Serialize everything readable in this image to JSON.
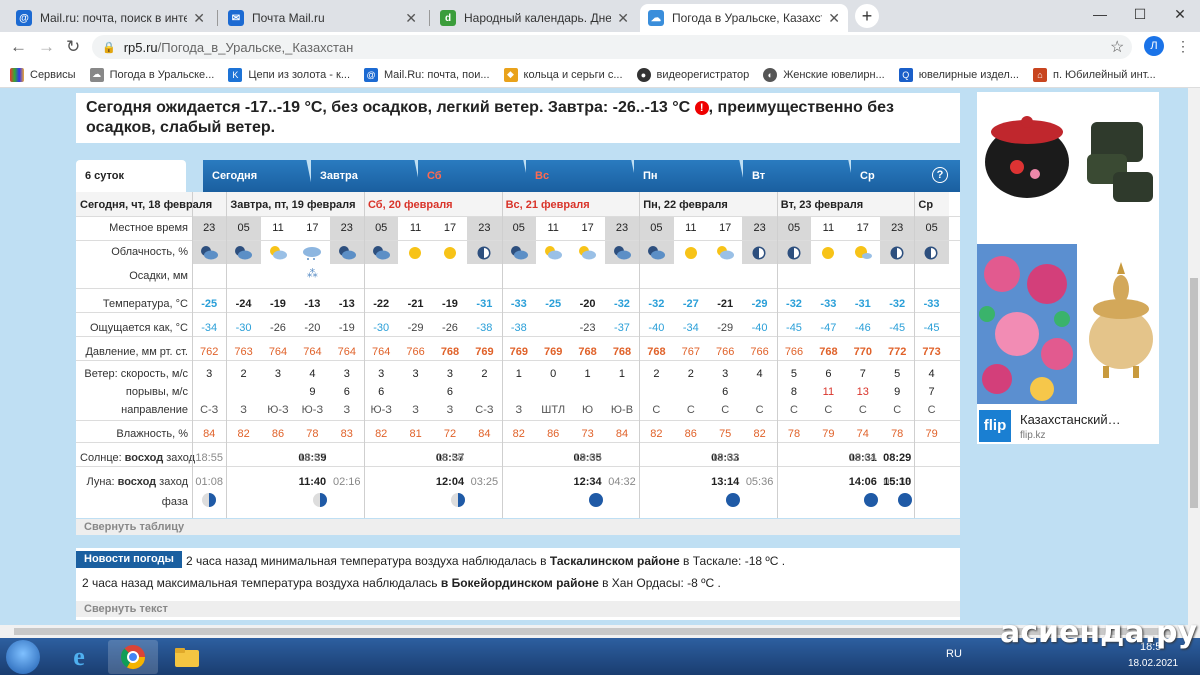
{
  "browser": {
    "tabs": [
      {
        "title": "Mail.ru: почта, поиск в интернете",
        "icon": "mailru-icon",
        "color": "#1c6ad2"
      },
      {
        "title": "Почта Mail.ru",
        "icon": "mail-icon",
        "color": "#1c6ad2"
      },
      {
        "title": "Народный календарь. Дневник",
        "icon": "calendar-icon",
        "color": "#3b9d3b"
      },
      {
        "title": "Погода в Уральске, Казахстан -",
        "icon": "weather-icon",
        "color": "#3a8edb"
      }
    ],
    "url_host": "rp5.ru",
    "url_path": "/Погода_в_Уральске,_Казахстан",
    "avatar_letter": "Л",
    "bookmarks": [
      "Сервисы",
      "Погода в Уральске...",
      "Цепи из золота - к...",
      "Mail.Ru: почта, пои...",
      "кольца и серьги с...",
      "видеорегистратор",
      "Женские ювелирн...",
      "ювелирные издел...",
      "п. Юбилейный инт..."
    ]
  },
  "forecast": {
    "line1": "Сегодня ожидается -17..-19 °С, без осадков, легкий ветер. Завтра: -26..-13 °С",
    "line1b": ", преимущественно без",
    "line2": "осадков, слабый ветер."
  },
  "weather_tabs": [
    {
      "label": "6 суток"
    },
    {
      "label": "Сегодня"
    },
    {
      "label": "Завтра"
    },
    {
      "label": "Сб",
      "red": true
    },
    {
      "label": "Вс",
      "red": true
    },
    {
      "label": "Пн"
    },
    {
      "label": "Вт"
    },
    {
      "label": "Ср"
    }
  ],
  "help_label": "?",
  "days": [
    {
      "title": "Сегодня, чт, 18 февраля",
      "red": false
    },
    {
      "title": "Завтра, пт, 19 февраля",
      "red": false
    },
    {
      "title": "Сб, 20 февраля",
      "red": true
    },
    {
      "title": "Вс, 21 февраля",
      "red": true
    },
    {
      "title": "Пн, 22 февраля",
      "red": false
    },
    {
      "title": "Вт, 23 февраля",
      "red": false
    },
    {
      "title": "Ср",
      "red": false
    }
  ],
  "row_labels": {
    "time": "Местное время",
    "cloud": "Облачность, %",
    "precip": "Осадки, мм",
    "temp": "Температура, °С",
    "feels": "Ощущается как, °С",
    "pressure": "Давление, мм рт. ст.",
    "wind_speed": "Ветер: скорость, м/с",
    "gusts": "порывы, м/с",
    "direction": "направление",
    "humidity": "Влажность, %",
    "sun_prefix": "Солнце:",
    "sun_rise": "восход",
    "sun_set": "заход",
    "moon_prefix": "Луна:",
    "moon_rise": "восход",
    "moon_set": "заход",
    "phase": "фаза"
  },
  "columns": [
    {
      "time": "23",
      "night": true,
      "icon": "cloud-moon",
      "temp": "-25",
      "feels": "-34",
      "pressure": "762",
      "wind": "3",
      "gust": "",
      "dir": "С-З",
      "hum": "84"
    },
    {
      "time": "05",
      "night": true,
      "icon": "cloud-moon",
      "temp": "-24",
      "feels": "-30",
      "pressure": "763",
      "wind": "2",
      "gust": "",
      "dir": "З",
      "hum": "82"
    },
    {
      "time": "11",
      "night": false,
      "icon": "cloud-sun",
      "temp": "-19",
      "feels": "-26",
      "pressure": "764",
      "wind": "3",
      "gust": "",
      "dir": "Ю-З",
      "hum": "86"
    },
    {
      "time": "17",
      "night": false,
      "icon": "cloud-snow",
      "temp": "-13",
      "feels": "-20",
      "pressure": "764",
      "wind": "4",
      "gust": "9",
      "dir": "Ю-З",
      "hum": "78"
    },
    {
      "time": "23",
      "night": true,
      "icon": "cloud-moon",
      "temp": "-13",
      "feels": "-19",
      "pressure": "764",
      "wind": "3",
      "gust": "6",
      "dir": "З",
      "hum": "83"
    },
    {
      "time": "05",
      "night": true,
      "icon": "cloud-moon",
      "temp": "-22",
      "feels": "-30",
      "pressure": "764",
      "wind": "3",
      "gust": "6",
      "dir": "Ю-З",
      "hum": "82"
    },
    {
      "time": "11",
      "night": false,
      "icon": "sun",
      "temp": "-21",
      "feels": "-29",
      "pressure": "766",
      "wind": "3",
      "gust": "",
      "dir": "З",
      "hum": "81"
    },
    {
      "time": "17",
      "night": false,
      "icon": "sun",
      "temp": "-19",
      "feels": "-26",
      "pressure": "768",
      "wind": "3",
      "gust": "6",
      "dir": "З",
      "hum": "72"
    },
    {
      "time": "23",
      "night": true,
      "icon": "moon",
      "temp": "-31",
      "feels": "-38",
      "pressure": "769",
      "wind": "2",
      "gust": "",
      "dir": "С-З",
      "hum": "84"
    },
    {
      "time": "05",
      "night": true,
      "icon": "cloud-moon",
      "temp": "-33",
      "feels": "-38",
      "pressure": "769",
      "wind": "1",
      "gust": "",
      "dir": "З",
      "hum": "82"
    },
    {
      "time": "11",
      "night": false,
      "icon": "cloud-sun",
      "temp": "-25",
      "feels": "",
      "pressure": "769",
      "wind": "0",
      "gust": "",
      "dir": "ШТЛ",
      "hum": "86"
    },
    {
      "time": "17",
      "night": false,
      "icon": "cloud-sun",
      "temp": "-20",
      "feels": "-23",
      "pressure": "768",
      "wind": "1",
      "gust": "",
      "dir": "Ю",
      "hum": "73"
    },
    {
      "time": "23",
      "night": true,
      "icon": "cloud-moon",
      "temp": "-32",
      "feels": "-37",
      "pressure": "768",
      "wind": "1",
      "gust": "",
      "dir": "Ю-В",
      "hum": "84"
    },
    {
      "time": "05",
      "night": true,
      "icon": "cloud-moon",
      "temp": "-32",
      "feels": "-40",
      "pressure": "768",
      "wind": "2",
      "gust": "",
      "dir": "С",
      "hum": "82"
    },
    {
      "time": "11",
      "night": false,
      "icon": "sun",
      "temp": "-27",
      "feels": "-34",
      "pressure": "767",
      "wind": "2",
      "gust": "",
      "dir": "С",
      "hum": "86"
    },
    {
      "time": "17",
      "night": false,
      "icon": "cloud-sun",
      "temp": "-21",
      "feels": "-29",
      "pressure": "766",
      "wind": "3",
      "gust": "6",
      "dir": "С",
      "hum": "75"
    },
    {
      "time": "23",
      "night": true,
      "icon": "moon",
      "temp": "-29",
      "feels": "-40",
      "pressure": "766",
      "wind": "4",
      "gust": "",
      "dir": "С",
      "hum": "82"
    },
    {
      "time": "05",
      "night": true,
      "icon": "moon",
      "temp": "-32",
      "feels": "-45",
      "pressure": "766",
      "wind": "5",
      "gust": "8",
      "dir": "С",
      "hum": "78"
    },
    {
      "time": "11",
      "night": false,
      "icon": "sun",
      "temp": "-33",
      "feels": "-47",
      "pressure": "768",
      "wind": "6",
      "gust": "11",
      "dir": "С",
      "hum": "79"
    },
    {
      "time": "17",
      "night": false,
      "icon": "sun-cloud",
      "temp": "-31",
      "feels": "-46",
      "pressure": "770",
      "wind": "7",
      "gust": "13",
      "dir": "С",
      "hum": "74"
    },
    {
      "time": "23",
      "night": true,
      "icon": "moon",
      "temp": "-32",
      "feels": "-45",
      "pressure": "772",
      "wind": "5",
      "gust": "9",
      "dir": "С",
      "hum": "78"
    },
    {
      "time": "05",
      "night": true,
      "icon": "moon",
      "temp": "-33",
      "feels": "-45",
      "pressure": "773",
      "wind": "4",
      "gust": "7",
      "dir": "С",
      "hum": "79"
    }
  ],
  "sun": [
    {
      "rise": "",
      "set": "18:55"
    },
    {
      "rise": "08:39",
      "set": "18:57"
    },
    {
      "rise": "08:37",
      "set": "18:58"
    },
    {
      "rise": "08:35",
      "set": "19:00"
    },
    {
      "rise": "08:33",
      "set": "19:02"
    },
    {
      "rise": "08:31",
      "set": "19:04"
    },
    {
      "rise": "08:29",
      "set": ""
    }
  ],
  "moon": [
    {
      "rise": "",
      "set": "01:08"
    },
    {
      "rise": "11:40",
      "set": "02:16"
    },
    {
      "rise": "12:04",
      "set": "03:25"
    },
    {
      "rise": "12:34",
      "set": "04:32"
    },
    {
      "rise": "13:14",
      "set": "05:36"
    },
    {
      "rise": "14:06",
      "set": "06:33"
    },
    {
      "rise": "15:10",
      "set": ""
    }
  ],
  "collapse_table": "Свернуть таблицу",
  "news": {
    "badge": "Новости погоды",
    "item1_pre": "2 часа назад минимальная температура воздуха наблюдалась в ",
    "item1_bold": "Таскалинском районе",
    "item1_post": " в Таскале: -18 ºC .",
    "item2_pre": "2 часа назад максимальная температура воздуха наблюдалась ",
    "item2_bold": "в Бокейординском районе",
    "item2_post": " в Хан Ордасы: -8 ºC .",
    "collapse": "Свернуть текст"
  },
  "ad": {
    "title": "Казахстанский…",
    "domain": "flip.kz",
    "logo": "flip"
  },
  "taskbar": {
    "lang": "RU",
    "time": "18:5",
    "date": "18.02.2021"
  },
  "watermark": "асиенда.ру",
  "colors": {
    "cold_temp": "#2a9fd8",
    "pressure": "#e0622a",
    "tab_blue": "#1a5fa0",
    "page_bg": "#bfdff3"
  }
}
